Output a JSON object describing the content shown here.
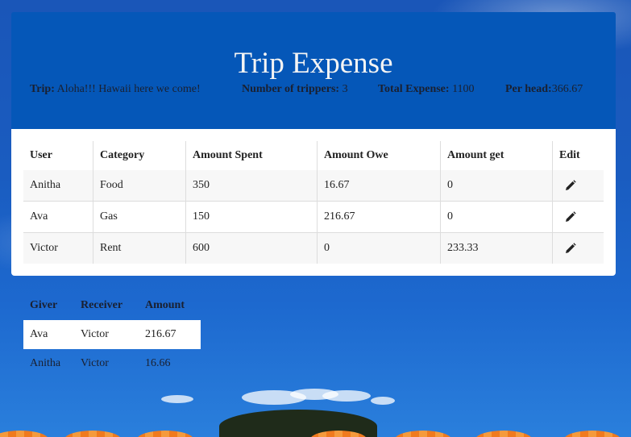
{
  "header": {
    "title": "Trip Expense",
    "trip_label": "Trip:",
    "trip_value": "Aloha!!! Hawaii here we come!",
    "trippers_label": "Number of trippers:",
    "trippers_value": "3",
    "total_label": "Total Expense:",
    "total_value": "1100",
    "perhead_label": "Per head:",
    "perhead_value": "366.67"
  },
  "expenses": {
    "columns": [
      "User",
      "Category",
      "Amount Spent",
      "Amount Owe",
      "Amount get",
      "Edit"
    ],
    "rows": [
      {
        "user": "Anitha",
        "category": "Food",
        "spent": "350",
        "owe": "16.67",
        "get": "0",
        "edit_icon": "pencil-icon"
      },
      {
        "user": "Ava",
        "category": "Gas",
        "spent": "150",
        "owe": "216.67",
        "get": "0",
        "edit_icon": "pencil-icon"
      },
      {
        "user": "Victor",
        "category": "Rent",
        "spent": "600",
        "owe": "0",
        "get": "233.33",
        "edit_icon": "pencil-icon"
      }
    ]
  },
  "settlements": {
    "columns": [
      "Giver",
      "Receiver",
      "Amount"
    ],
    "rows": [
      {
        "giver": "Ava",
        "receiver": "Victor",
        "amount": "216.67"
      },
      {
        "giver": "Anitha",
        "receiver": "Victor",
        "amount": "16.66"
      }
    ]
  },
  "colors": {
    "header_bg": "#0557b8",
    "panel_bg": "#ffffff",
    "row_alt_bg": "#f7f7f7"
  }
}
